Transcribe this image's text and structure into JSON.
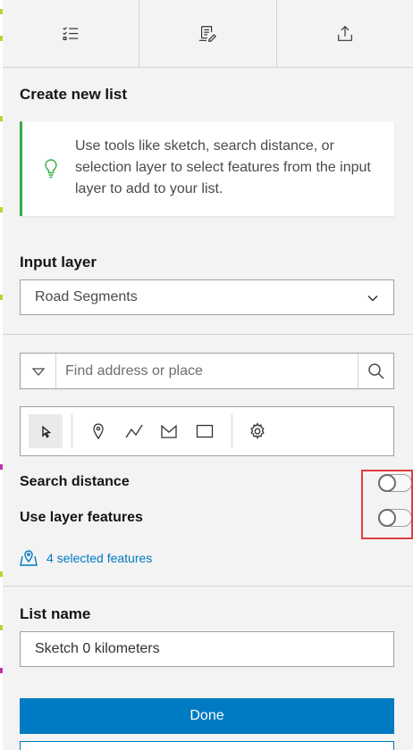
{
  "tabs": [
    {
      "icon": "checklist-icon"
    },
    {
      "icon": "list-edit-icon"
    },
    {
      "icon": "export-icon"
    }
  ],
  "create_section": {
    "title": "Create new list",
    "notice_icon": "lightbulb-icon",
    "notice_text": "Use tools like sketch, search distance, or selection layer to select features from the input layer to add to your list."
  },
  "input_layer": {
    "label": "Input layer",
    "selected": "Road Segments"
  },
  "search": {
    "placeholder": "Find address or place"
  },
  "sketch_tools": [
    {
      "icon": "cursor-icon",
      "active": true
    },
    {
      "icon": "point-pin-icon"
    },
    {
      "icon": "polyline-icon"
    },
    {
      "icon": "polygon-icon"
    },
    {
      "icon": "rectangle-icon"
    },
    {
      "icon": "gear-icon"
    }
  ],
  "toggles": {
    "search_distance": {
      "label": "Search distance",
      "on": false
    },
    "use_layer_features": {
      "label": "Use layer features",
      "on": false
    }
  },
  "selected_features_link": "4 selected features",
  "list_name": {
    "label": "List name",
    "value": "Sketch 0 kilometers"
  },
  "done_label": "Done",
  "colors": {
    "accent": "#007ac2",
    "notice_border": "#35ac46",
    "highlight": "#e03d3d"
  }
}
